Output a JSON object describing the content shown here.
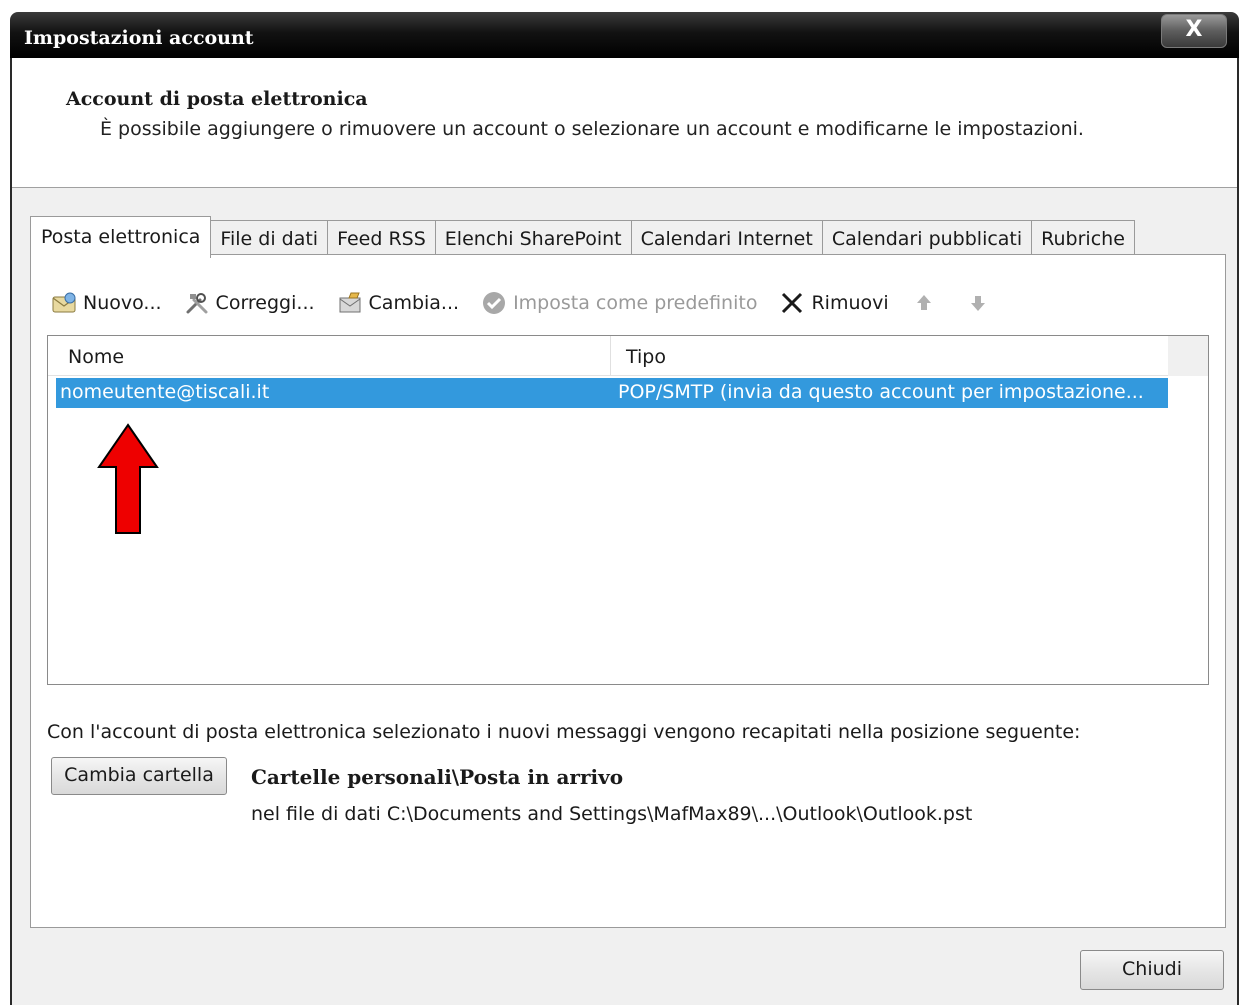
{
  "window": {
    "title": "Impostazioni account",
    "close_glyph": "X"
  },
  "header": {
    "title": "Account di posta elettronica",
    "description": "È possibile aggiungere o rimuovere un account o selezionare un account e modificarne le impostazioni."
  },
  "tabs": [
    {
      "label": "Posta elettronica",
      "active": true
    },
    {
      "label": "File di dati",
      "active": false
    },
    {
      "label": "Feed RSS",
      "active": false
    },
    {
      "label": "Elenchi SharePoint",
      "active": false
    },
    {
      "label": "Calendari Internet",
      "active": false
    },
    {
      "label": "Calendari pubblicati",
      "active": false
    },
    {
      "label": "Rubriche",
      "active": false
    }
  ],
  "toolbar": {
    "new_label": "Nuovo...",
    "repair_label": "Correggi...",
    "change_label": "Cambia...",
    "set_default_label": "Imposta come predefinito",
    "remove_label": "Rimuovi",
    "icons": {
      "new": "envelope-icon",
      "repair": "tools-icon",
      "change": "edit-account-icon",
      "set_default": "check-circle-icon",
      "remove": "x-icon",
      "move_up": "arrow-up-icon",
      "move_down": "arrow-down-icon"
    }
  },
  "accounts_list": {
    "columns": [
      "Nome",
      "Tipo"
    ],
    "rows": [
      {
        "name": "nomeutente@tiscali.it",
        "type": "POP/SMTP (invia da questo account per impostazione...",
        "selected": true
      }
    ]
  },
  "delivery": {
    "description": "Con l'account di posta elettronica selezionato i nuovi messaggi vengono recapitati nella posizione seguente:",
    "change_folder_label": "Cambia cartella",
    "folder_name": "Cartelle personali\\Posta in arrivo",
    "folder_path": "nel file di dati C:\\Documents and Settings\\MafMax89\\...\\Outlook\\Outlook.pst"
  },
  "footer": {
    "close_label": "Chiudi"
  },
  "colors": {
    "selection": "#3399dd",
    "annotation_arrow": "#ee0000",
    "titlebar": "#000000"
  }
}
